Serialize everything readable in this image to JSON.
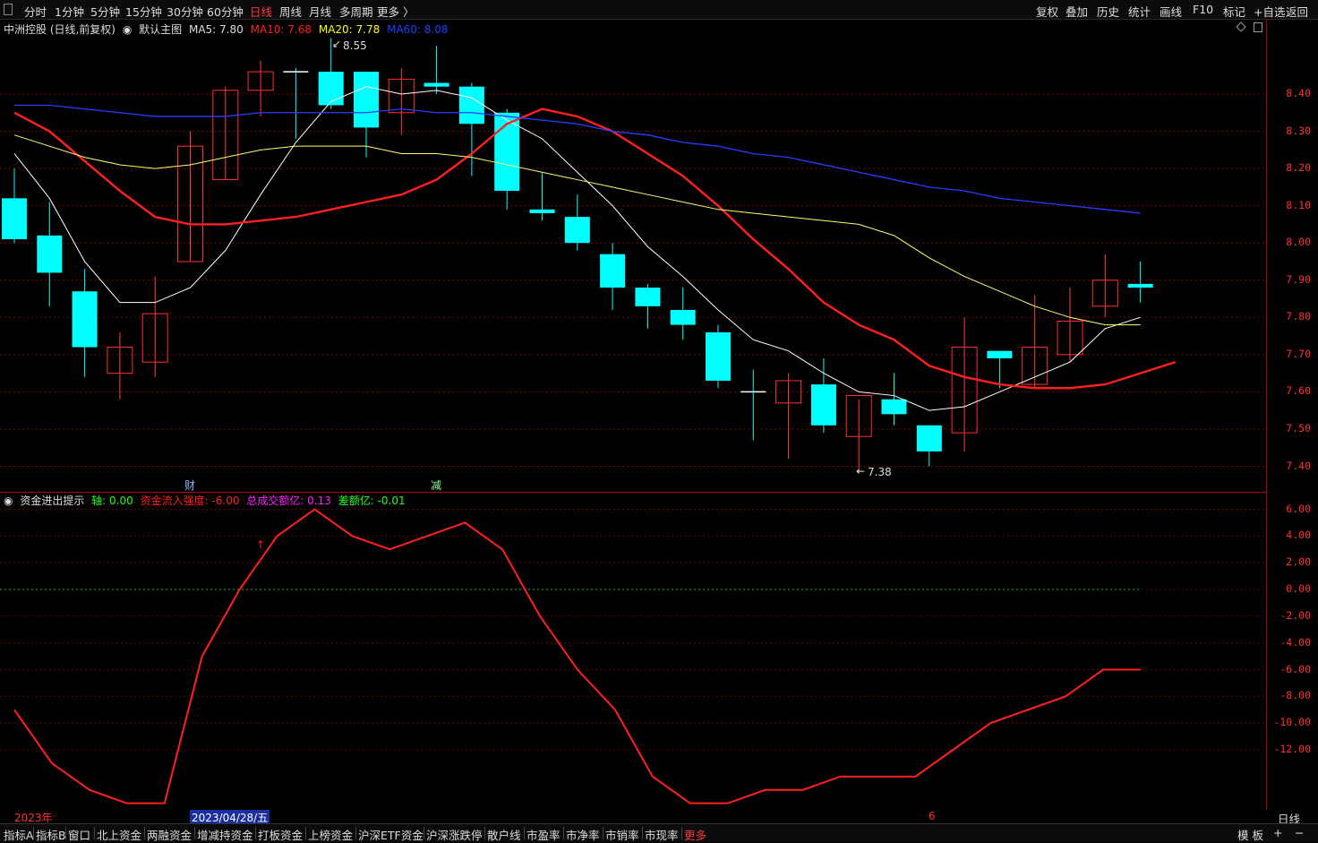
{
  "toolbar": {
    "periods": [
      "分时",
      "1分钟",
      "5分钟",
      "15分钟",
      "30分钟",
      "60分钟",
      "日线",
      "周线",
      "月线",
      "多周期",
      "更多 〉"
    ],
    "selected_period": "日线",
    "right_actions": [
      "复权",
      "叠加",
      "历史",
      "统计",
      "画线",
      "F10",
      "标记",
      "+自选",
      "返回"
    ]
  },
  "main_header": {
    "stock": "中洲控股 (日线,前复权)",
    "template": "默认主图",
    "ma5": "MA5: 7.80",
    "ma10": "MA10: 7.68",
    "ma20": "MA20: 7.78",
    "ma60": "MA60: 8.08"
  },
  "sub_header": {
    "name": "资金进出提示",
    "axis": "轴: 0.00",
    "strength": "资金流入强度: -6.00",
    "volume": "总成交额亿: 0.13",
    "diff": "差额亿: -0.01"
  },
  "annotations": {
    "high": "8.55",
    "low": "7.38",
    "mark_cai": "财",
    "mark_jian": "减"
  },
  "price_axis": [
    "8.40",
    "8.30",
    "8.20",
    "8.10",
    "8.00",
    "7.90",
    "7.80",
    "7.70",
    "7.60",
    "7.50",
    "7.40"
  ],
  "sub_axis": [
    "6.00",
    "4.00",
    "2.00",
    "0.00",
    "-2.00",
    "-4.00",
    "-6.00",
    "-8.00",
    "-10.00",
    "-12.00"
  ],
  "dates": {
    "year": "2023年",
    "selected": "2023/04/28/五",
    "month": "6"
  },
  "period_label": "日线",
  "bottom_tabs": [
    "指标A",
    "指标B",
    "窗口",
    "北上资金",
    "两融资金",
    "增减持资金",
    "打板资金",
    "上榜资金",
    "沪深ETF资金",
    "沪深涨跌停",
    "散户线",
    "市盈率",
    "市净率",
    "市销率",
    "市现率",
    "更多"
  ],
  "bottom_right": [
    "模 板",
    "+",
    "−"
  ],
  "colors": {
    "up": "#ff3030",
    "down": "#00ffff",
    "ma5": "#ffffff",
    "ma10": "#ff2020",
    "ma20": "#ffff00",
    "ma60": "#2040ff",
    "flow": "#ff2020"
  },
  "chart_data": [
    {
      "type": "candlestick",
      "title": "中洲控股 (日线,前复权)",
      "ylim": [
        7.35,
        8.6
      ],
      "candles": [
        {
          "o": 8.12,
          "h": 8.2,
          "l": 8.0,
          "c": 8.01
        },
        {
          "o": 8.02,
          "h": 8.11,
          "l": 7.83,
          "c": 7.92
        },
        {
          "o": 7.87,
          "h": 7.93,
          "l": 7.64,
          "c": 7.72
        },
        {
          "o": 7.65,
          "h": 7.76,
          "l": 7.58,
          "c": 7.72
        },
        {
          "o": 7.68,
          "h": 7.91,
          "l": 7.64,
          "c": 7.81
        },
        {
          "o": 7.95,
          "h": 8.3,
          "l": 7.95,
          "c": 8.26
        },
        {
          "o": 8.17,
          "h": 8.42,
          "l": 8.17,
          "c": 8.41
        },
        {
          "o": 8.41,
          "h": 8.49,
          "l": 8.34,
          "c": 8.46
        },
        {
          "o": 8.46,
          "h": 8.47,
          "l": 8.28,
          "c": 8.46
        },
        {
          "o": 8.46,
          "h": 8.55,
          "l": 8.36,
          "c": 8.37
        },
        {
          "o": 8.46,
          "h": 8.46,
          "l": 8.23,
          "c": 8.31
        },
        {
          "o": 8.35,
          "h": 8.47,
          "l": 8.29,
          "c": 8.44
        },
        {
          "o": 8.43,
          "h": 8.53,
          "l": 8.4,
          "c": 8.42
        },
        {
          "o": 8.42,
          "h": 8.43,
          "l": 8.18,
          "c": 8.32
        },
        {
          "o": 8.35,
          "h": 8.36,
          "l": 8.09,
          "c": 8.14
        },
        {
          "o": 8.09,
          "h": 8.19,
          "l": 8.06,
          "c": 8.08
        },
        {
          "o": 8.07,
          "h": 8.13,
          "l": 7.98,
          "c": 8.0
        },
        {
          "o": 7.97,
          "h": 8.0,
          "l": 7.82,
          "c": 7.88
        },
        {
          "o": 7.88,
          "h": 7.89,
          "l": 7.77,
          "c": 7.83
        },
        {
          "o": 7.82,
          "h": 7.88,
          "l": 7.74,
          "c": 7.78
        },
        {
          "o": 7.76,
          "h": 7.78,
          "l": 7.61,
          "c": 7.63
        },
        {
          "o": 7.6,
          "h": 7.66,
          "l": 7.47,
          "c": 7.6
        },
        {
          "o": 7.57,
          "h": 7.65,
          "l": 7.42,
          "c": 7.63
        },
        {
          "o": 7.62,
          "h": 7.69,
          "l": 7.49,
          "c": 7.51
        },
        {
          "o": 7.48,
          "h": 7.58,
          "l": 7.38,
          "c": 7.59
        },
        {
          "o": 7.58,
          "h": 7.65,
          "l": 7.51,
          "c": 7.54
        },
        {
          "o": 7.51,
          "h": 7.51,
          "l": 7.4,
          "c": 7.44
        },
        {
          "o": 7.49,
          "h": 7.8,
          "l": 7.44,
          "c": 7.72
        },
        {
          "o": 7.71,
          "h": 7.71,
          "l": 7.61,
          "c": 7.69
        },
        {
          "o": 7.62,
          "h": 7.86,
          "l": 7.61,
          "c": 7.72
        },
        {
          "o": 7.7,
          "h": 7.88,
          "l": 7.68,
          "c": 7.79
        },
        {
          "o": 7.83,
          "h": 7.97,
          "l": 7.8,
          "c": 7.9
        },
        {
          "o": 7.89,
          "h": 7.95,
          "l": 7.84,
          "c": 7.88
        }
      ],
      "series": [
        {
          "name": "MA5",
          "values": [
            8.24,
            8.12,
            7.95,
            7.84,
            7.84,
            7.88,
            7.98,
            8.13,
            8.27,
            8.38,
            8.42,
            8.4,
            8.41,
            8.39,
            8.33,
            8.28,
            8.19,
            8.1,
            7.99,
            7.91,
            7.82,
            7.74,
            7.71,
            7.65,
            7.6,
            7.59,
            7.55,
            7.56,
            7.6,
            7.64,
            7.68,
            7.77,
            7.8
          ]
        },
        {
          "name": "MA10",
          "values": [
            8.35,
            8.3,
            8.22,
            8.14,
            8.07,
            8.05,
            8.05,
            8.06,
            8.07,
            8.09,
            8.11,
            8.13,
            8.17,
            8.24,
            8.32,
            8.36,
            8.34,
            8.3,
            8.24,
            8.18,
            8.1,
            8.01,
            7.93,
            7.84,
            7.78,
            7.74,
            7.67,
            7.64,
            7.62,
            7.61,
            7.61,
            7.62,
            7.65,
            7.68
          ]
        },
        {
          "name": "MA20",
          "values": [
            8.29,
            8.26,
            8.23,
            8.21,
            8.2,
            8.21,
            8.23,
            8.25,
            8.26,
            8.26,
            8.26,
            8.24,
            8.24,
            8.23,
            8.21,
            8.19,
            8.17,
            8.15,
            8.13,
            8.11,
            8.09,
            8.08,
            8.07,
            8.06,
            8.05,
            8.02,
            7.96,
            7.91,
            7.87,
            7.83,
            7.8,
            7.78,
            7.78
          ]
        },
        {
          "name": "MA60",
          "values": [
            8.37,
            8.37,
            8.36,
            8.35,
            8.34,
            8.34,
            8.34,
            8.35,
            8.35,
            8.35,
            8.35,
            8.36,
            8.35,
            8.35,
            8.34,
            8.33,
            8.32,
            8.3,
            8.29,
            8.27,
            8.26,
            8.24,
            8.23,
            8.21,
            8.19,
            8.17,
            8.15,
            8.14,
            8.12,
            8.11,
            8.1,
            8.09,
            8.08
          ]
        }
      ]
    },
    {
      "type": "line",
      "title": "资金进出提示",
      "ylim": [
        -16,
        7
      ],
      "series": [
        {
          "name": "资金流入强度",
          "values": [
            -9,
            -13,
            -15,
            -16,
            -16,
            -5,
            0,
            4,
            6,
            4,
            3,
            4,
            5,
            3,
            -2,
            -6,
            -9,
            -14,
            -16,
            -16,
            -15,
            -15,
            -14,
            -14,
            -14,
            -12,
            -10,
            -9,
            -8,
            -6,
            -6
          ]
        }
      ]
    }
  ]
}
